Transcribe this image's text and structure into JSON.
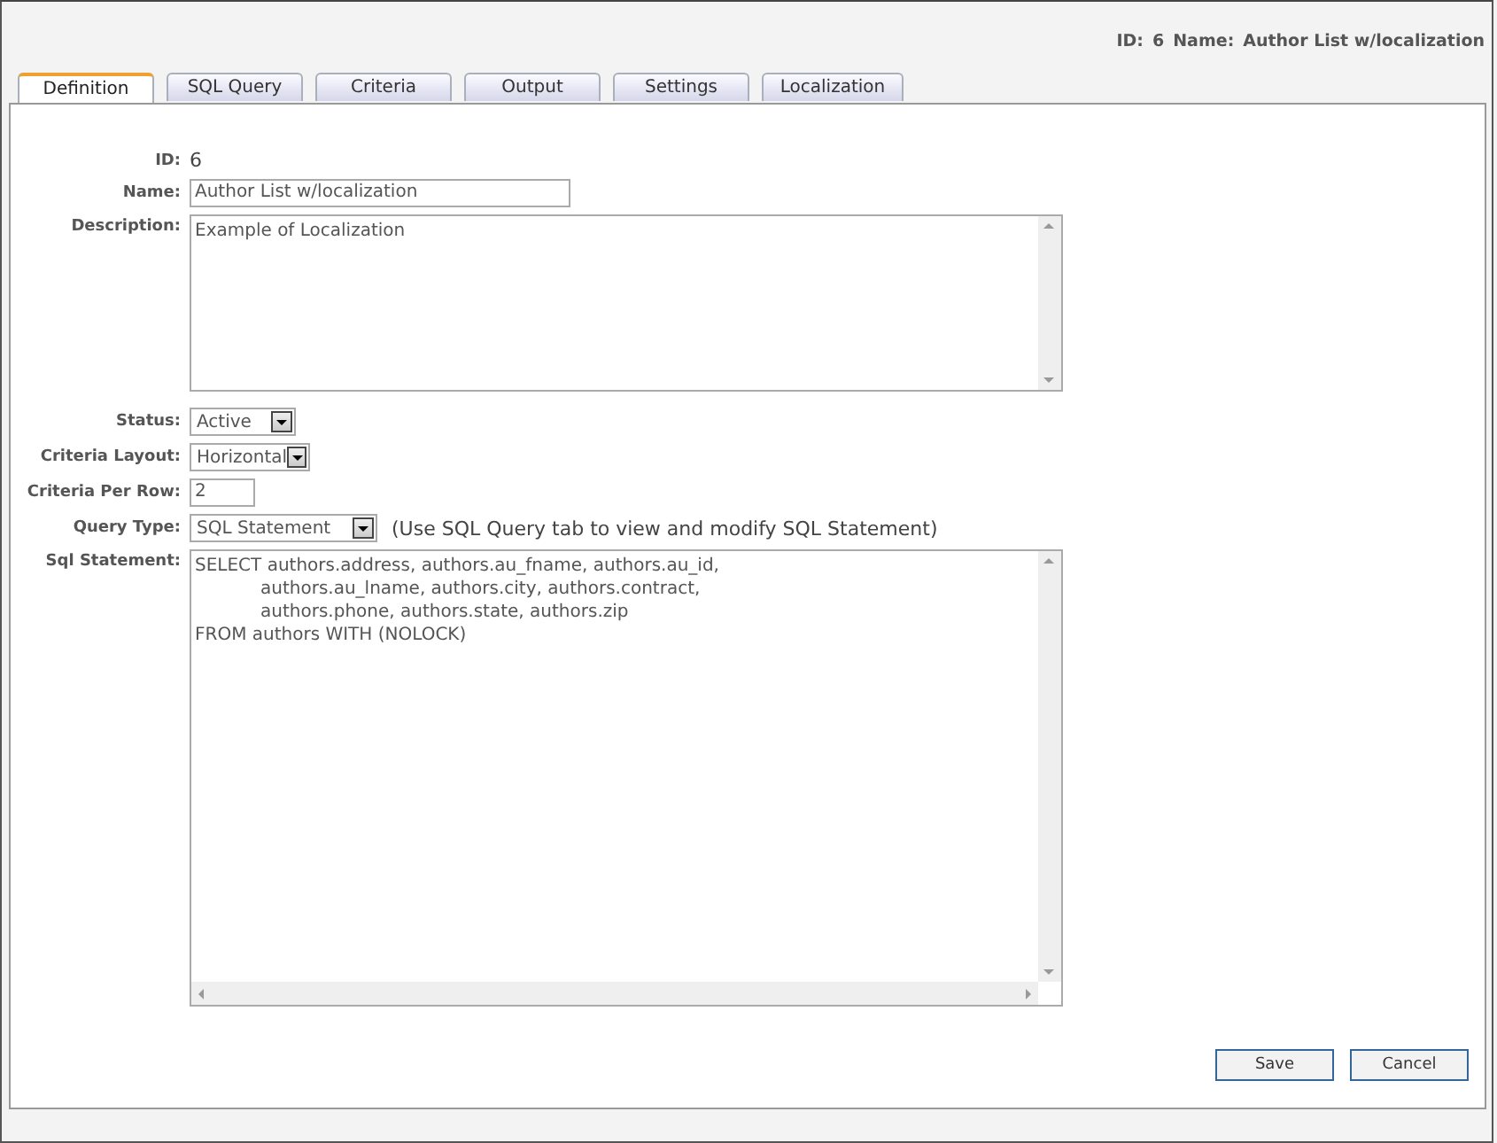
{
  "header": {
    "id_label": "ID:",
    "id_value": "6",
    "name_label": "Name:",
    "name_value": "Author List w/localization"
  },
  "tabs": [
    {
      "label": "Definition",
      "selected": true
    },
    {
      "label": "SQL Query",
      "selected": false
    },
    {
      "label": "Criteria",
      "selected": false
    },
    {
      "label": "Output",
      "selected": false
    },
    {
      "label": "Settings",
      "selected": false
    },
    {
      "label": "Localization",
      "selected": false
    }
  ],
  "form": {
    "id": {
      "label": "ID:",
      "value": "6"
    },
    "name": {
      "label": "Name:",
      "value": "Author List w/localization"
    },
    "description": {
      "label": "Description:",
      "value": "Example of Localization"
    },
    "status": {
      "label": "Status:",
      "value": "Active"
    },
    "criteria_layout": {
      "label": "Criteria Layout:",
      "value": "Horizontal"
    },
    "criteria_per_row": {
      "label": "Criteria Per Row:",
      "value": "2"
    },
    "query_type": {
      "label": "Query Type:",
      "value": "SQL Statement",
      "note": "(Use SQL Query tab to view and modify SQL Statement)"
    },
    "sql_statement": {
      "label": "Sql Statement:",
      "lines": [
        {
          "kind": "plain",
          "text": "SELECT authors.address, authors.au_fname, authors.au_id,"
        },
        {
          "kind": "indented",
          "text": "authors.au_lname, authors.city, authors.contract,"
        },
        {
          "kind": "indented",
          "text": "authors.phone, authors.state, authors.zip"
        },
        {
          "kind": "plain",
          "text": "FROM authors WITH (NOLOCK)"
        }
      ]
    }
  },
  "buttons": [
    "Save",
    "Cancel"
  ]
}
